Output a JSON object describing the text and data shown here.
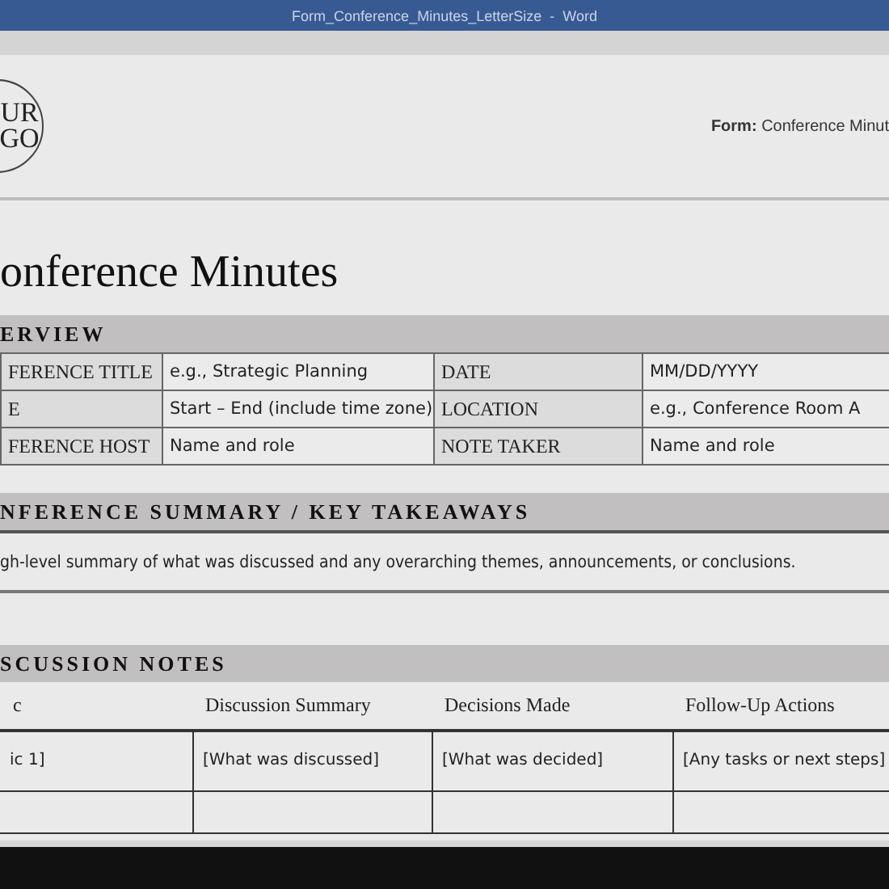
{
  "window": {
    "title": "Form_Conference_Minutes_LetterSize  -  Word"
  },
  "header": {
    "logo_lines": [
      "UR",
      "GO"
    ],
    "form_label": "Form:",
    "form_name": "Conference Minut"
  },
  "document_title": "onference Minutes",
  "overview": {
    "heading": "ERVIEW",
    "rows": [
      {
        "cells": [
          {
            "text": "FERENCE TITLE",
            "kind": "label"
          },
          {
            "text": "e.g., Strategic Planning",
            "kind": "value"
          },
          {
            "text": "DATE",
            "kind": "label"
          },
          {
            "text": "MM/DD/YYYY",
            "kind": "value"
          }
        ]
      },
      {
        "cells": [
          {
            "text": "E",
            "kind": "label"
          },
          {
            "text": "Start – End (include time zone)",
            "kind": "value"
          },
          {
            "text": "LOCATION",
            "kind": "label"
          },
          {
            "text": "e.g., Conference Room A",
            "kind": "value"
          }
        ]
      },
      {
        "cells": [
          {
            "text": "FERENCE HOST",
            "kind": "label"
          },
          {
            "text": "Name and role",
            "kind": "value"
          },
          {
            "text": "NOTE TAKER",
            "kind": "label"
          },
          {
            "text": "Name and role",
            "kind": "value"
          }
        ]
      }
    ]
  },
  "summary": {
    "heading": "NFERENCE SUMMARY / KEY TAKEAWAYS",
    "text": "gh-level summary of what was discussed and any overarching themes, announcements, or conclusions."
  },
  "discussion": {
    "heading": "SCUSSION NOTES",
    "columns": [
      "c",
      "Discussion Summary",
      "Decisions Made",
      "Follow-Up Actions"
    ],
    "rows": [
      [
        "ic 1]",
        "[What was discussed]",
        "[What was decided]",
        "[Any tasks or next steps]"
      ]
    ]
  }
}
